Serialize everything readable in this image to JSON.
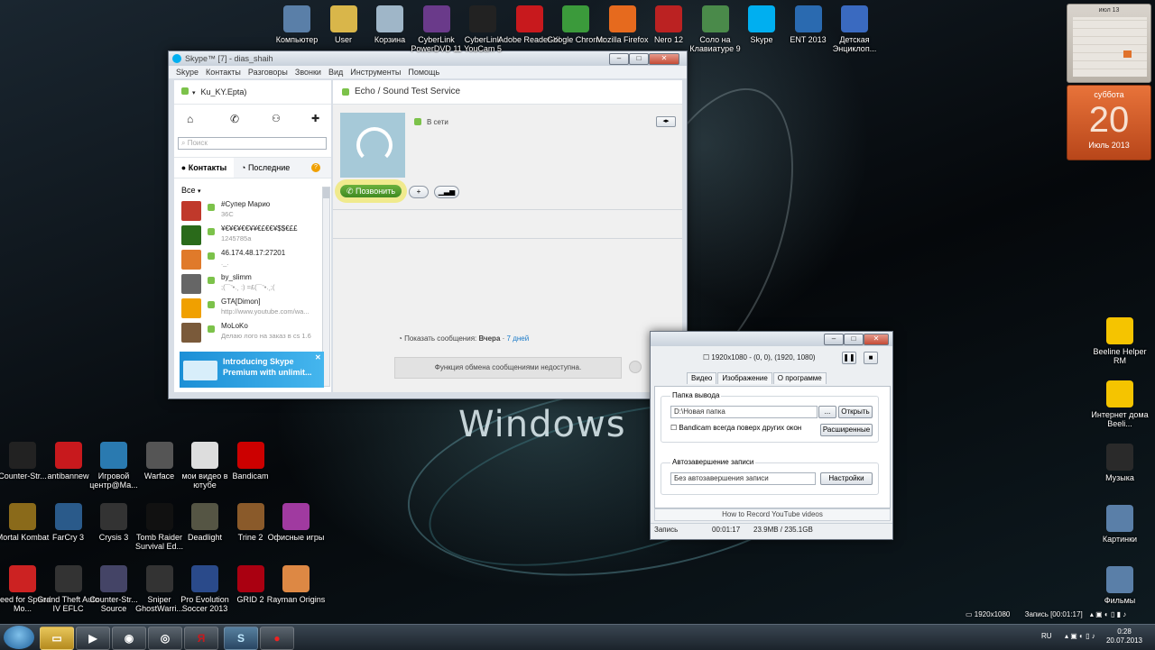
{
  "desktop": {
    "wallpaper_text": "Windows",
    "top_icons": [
      {
        "label": "Компьютер",
        "icon": "computer-icon",
        "color": "#5a7fa8"
      },
      {
        "label": "User",
        "icon": "user-folder-icon",
        "color": "#d9b64a"
      },
      {
        "label": "Корзина",
        "icon": "recycle-bin-icon",
        "color": "#9fb6c8"
      },
      {
        "label": "CyberLink PowerDVD 11",
        "icon": "powerdvd-icon",
        "color": "#6a3a8a"
      },
      {
        "label": "CyberLink YouCam 5",
        "icon": "youcam-icon",
        "color": "#222222"
      },
      {
        "label": "Adobe Reader XI",
        "icon": "adobe-reader-icon",
        "color": "#c8191d"
      },
      {
        "label": "Google Chrome",
        "icon": "chrome-icon",
        "color": "#3b9a3b"
      },
      {
        "label": "Mozilla Firefox",
        "icon": "firefox-icon",
        "color": "#e66a1e"
      },
      {
        "label": "Nero 12",
        "icon": "nero-icon",
        "color": "#b22"
      },
      {
        "label": "Соло на Клавиатуре 9",
        "icon": "solo-icon",
        "color": "#4a8a4a"
      },
      {
        "label": "Skype",
        "icon": "skype-icon",
        "color": "#00aff0"
      },
      {
        "label": "ENT 2013",
        "icon": "ent-icon",
        "color": "#2a6ab0"
      },
      {
        "label": "Детская Энциклоп...",
        "icon": "encyclopedia-icon",
        "color": "#3a6ac0"
      }
    ],
    "bottom_row1": [
      {
        "label": "Counter-Str...",
        "icon": "counter-strike-icon",
        "color": "#222"
      },
      {
        "label": "antibannew",
        "icon": "pdf-icon",
        "color": "#c8191d"
      },
      {
        "label": "Игровой центр@Ма...",
        "icon": "game-center-icon",
        "color": "#2a7ab0"
      },
      {
        "label": "Warface",
        "icon": "warface-icon",
        "color": "#555"
      },
      {
        "label": "мои видео в ютубе",
        "icon": "document-icon",
        "color": "#ddd"
      },
      {
        "label": "Bandicam",
        "icon": "bandicam-icon",
        "color": "#c00"
      }
    ],
    "bottom_row2": [
      {
        "label": "Mortal Kombat",
        "icon": "mortal-kombat-icon",
        "color": "#8a6a1a"
      },
      {
        "label": "FarCry 3",
        "icon": "farcry-icon",
        "color": "#2a5a8a"
      },
      {
        "label": "Crysis 3",
        "icon": "crysis-icon",
        "color": "#333"
      },
      {
        "label": "Tomb Raider Survival Ed...",
        "icon": "tomb-raider-icon",
        "color": "#111"
      },
      {
        "label": "Deadlight",
        "icon": "deadlight-icon",
        "color": "#554"
      },
      {
        "label": "Trine 2",
        "icon": "trine-icon",
        "color": "#8a5a2a"
      },
      {
        "label": "Офисные игры",
        "icon": "office-games-icon",
        "color": "#a03aa0"
      }
    ],
    "bottom_row3": [
      {
        "label": "Need for Speed Mo...",
        "icon": "nfs-icon",
        "color": "#c22"
      },
      {
        "label": "Grand Theft Auto IV EFLC",
        "icon": "gta-icon",
        "color": "#333"
      },
      {
        "label": "Counter-Str... Source",
        "icon": "cs-source-icon",
        "color": "#446"
      },
      {
        "label": "Sniper GhostWarri...",
        "icon": "sniper-icon",
        "color": "#333"
      },
      {
        "label": "Pro Evolution Soccer 2013",
        "icon": "pes-icon",
        "color": "#2a4a8a"
      },
      {
        "label": "GRID 2",
        "icon": "grid-icon",
        "color": "#a01"
      },
      {
        "label": "Rayman Origins",
        "icon": "rayman-icon",
        "color": "#d84"
      }
    ],
    "right_icons": [
      {
        "label": "Beeline Helper RM",
        "icon": "beeline-helper-icon",
        "color": "#f5c400"
      },
      {
        "label": "Интернет дома Beeli...",
        "icon": "beeline-icon",
        "color": "#f5c400"
      },
      {
        "label": "Музыка",
        "icon": "music-icon",
        "color": "#2a2a2a"
      },
      {
        "label": "Картинки",
        "icon": "pictures-icon",
        "color": "#5a7fa8"
      },
      {
        "label": "Фильмы",
        "icon": "films-icon",
        "color": "#5a7fa8"
      }
    ]
  },
  "calendar": {
    "month_header": "июл 13",
    "weekday": "суббота",
    "day": "20",
    "month_year": "Июль 2013"
  },
  "skype": {
    "title": "Skype™ [7] - dias_shaih",
    "menu": [
      "Skype",
      "Контакты",
      "Разговоры",
      "Звонки",
      "Вид",
      "Инструменты",
      "Помощь"
    ],
    "username": "Ku_KY.Epta)",
    "search_placeholder": "Поиск",
    "tab_contacts": "Контакты",
    "tab_recent": "Последние",
    "filter": "Все",
    "contacts": [
      {
        "name": "#Супер Марио",
        "sub": "36C",
        "color": "#c0392b"
      },
      {
        "name": "¥€¥€¥€€¥¥€£€€¥$$€££",
        "sub": "1245785a",
        "color": "#2a6a1a"
      },
      {
        "name": "46.174.48.17:27201",
        "sub": "._.",
        "color": "#e07a2a"
      },
      {
        "name": "by_slimm",
        "sub": ";(¯`'•.¸ :) =£(¯`'•.¸;(",
        "color": "#666"
      },
      {
        "name": "GTA[Dimon]",
        "sub": "http://www.youtube.com/wa...",
        "color": "#f0a000"
      },
      {
        "name": "MoLoKo",
        "sub": "Делаю лого на заказ в cs 1.6",
        "color": "#7a5a3a"
      }
    ],
    "ad_line1": "Introducing Skype",
    "ad_line2": "Premium with unlimit...",
    "chat_title": "Echo / Sound Test Service",
    "status_text": "В сети",
    "call_button": "Позвонить",
    "add_button": "+",
    "history_label": "Показать сообщения:",
    "history_yesterday": "Вчера",
    "history_sep": "·",
    "history_week": "7 дней",
    "unavailable": "Функция обмена сообщениями недоступна."
  },
  "bandicam": {
    "size_info": "1920x1080 - (0, 0), (1920, 1080)",
    "tabs": [
      "Видео",
      "Изображение",
      "О программе"
    ],
    "output_group": "Папка вывода",
    "output_path": "D:\\Новая папка",
    "browse_btn": "...",
    "open_btn": "Открыть",
    "on_top_label": "Bandicam всегда поверх других окон",
    "advanced_btn": "Расширенные",
    "autostop_group": "Автозавершение записи",
    "autostop_value": "Без автозавершения записи",
    "settings_btn": "Настройки",
    "help_link": "How to Record YouTube videos",
    "status_label": "Запись",
    "status_time": "00:01:17",
    "status_size": "23.9MB / 235.1GB"
  },
  "taskbar": {
    "recording_resolution": "1920x1080",
    "recording_time": "Запись [00:01:17]",
    "language": "RU",
    "clock_time": "0:28",
    "clock_date": "20.07.2013"
  }
}
